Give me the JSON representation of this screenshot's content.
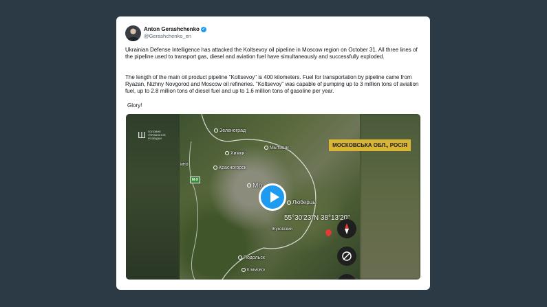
{
  "tweet": {
    "author_name": "Anton Gerashchenko",
    "author_handle": "@Gerashchenko_en",
    "verified_icon": "verified-badge-icon",
    "paragraphs": [
      "Ukrainian Defense Intelligence has attacked the Koltsevoy oil pipeline in Moscow region on October 31. All three lines of the pipeline used to transport gas, diesel and aviation fuel have simultaneously and successfully exploded.",
      "The length of the main oil product pipeline \"Koltsevoy\" is 400 kilometers. Fuel for transportation by pipeline came from Ryazan, Nizhny Novgorod and Moscow oil refineries. \"Koltsevoy\" was capable of pumping up to 3 million tons of aviation fuel, up to 2.8 million tons of diesel fuel and up to 1.6 million tons of gasoline per year.",
      "Glory!"
    ]
  },
  "video": {
    "logo_text": "Головне управління розвідки",
    "region_label": "МОСКОВСЬКА ОБЛ., РОСІЯ",
    "cities": [
      "Зеленоград",
      "Химки",
      "Мытищи",
      "Красногорск",
      "ино",
      "Мо",
      "Люберцы",
      "Жуковский",
      "Подольск",
      "Климовск"
    ],
    "road_label": "M-9",
    "coordinates": "55°30'23\"N 38°13'20\"",
    "play_icon": "play-icon",
    "compass_icon": "compass-icon",
    "recenter_icon": "recenter-icon"
  }
}
